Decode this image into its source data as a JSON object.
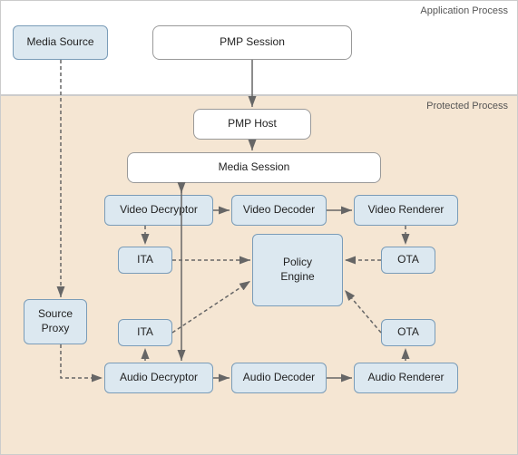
{
  "regions": {
    "app_label": "Application Process",
    "protected_label": "Protected Process"
  },
  "boxes": {
    "media_source": "Media Source",
    "pmp_session": "PMP Session",
    "pmp_host": "PMP Host",
    "media_session": "Media Session",
    "video_decryptor": "Video Decryptor",
    "video_decoder": "Video Decoder",
    "video_renderer": "Video Renderer",
    "ita_top": "ITA",
    "ota_top": "OTA",
    "policy_engine": "Policy\nEngine",
    "ita_bottom": "ITA",
    "ota_bottom": "OTA",
    "audio_decryptor": "Audio Decryptor",
    "audio_decoder": "Audio Decoder",
    "audio_renderer": "Audio Renderer",
    "source_proxy": "Source\nProxy"
  }
}
